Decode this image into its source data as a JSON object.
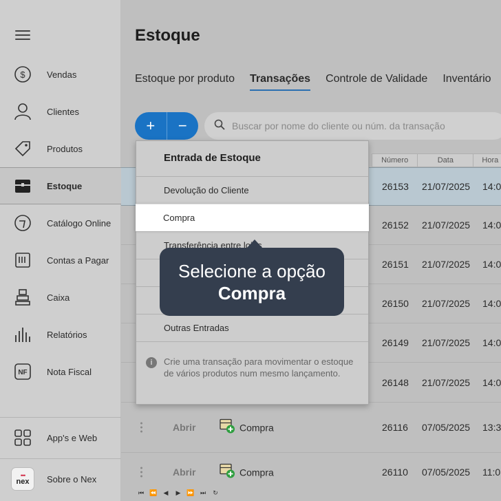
{
  "sidebar": {
    "items": [
      {
        "label": "Vendas",
        "icon": "dollar-circle-icon"
      },
      {
        "label": "Clientes",
        "icon": "person-icon"
      },
      {
        "label": "Produtos",
        "icon": "tag-icon"
      },
      {
        "label": "Estoque",
        "icon": "box-icon"
      },
      {
        "label": "Catálogo Online",
        "icon": "catalog-icon"
      },
      {
        "label": "Contas a Pagar",
        "icon": "bill-icon"
      },
      {
        "label": "Caixa",
        "icon": "cash-register-icon"
      },
      {
        "label": "Relatórios",
        "icon": "bar-chart-icon"
      },
      {
        "label": "Nota Fiscal",
        "icon": "nf-icon"
      }
    ],
    "apps_label": "App's e Web",
    "about_label": "Sobre o Nex",
    "logo_text": "nex"
  },
  "page": {
    "title": "Estoque",
    "tabs": [
      "Estoque por produto",
      "Transações",
      "Controle de Validade",
      "Inventário"
    ],
    "active_tab": "Transações",
    "add_symbol": "+",
    "remove_symbol": "−",
    "search_placeholder": "Buscar por nome do cliente ou núm. da transação"
  },
  "table": {
    "columns": [
      "Número",
      "Data",
      "Hora"
    ],
    "rows": [
      {
        "numero": "26153",
        "data": "21/07/2025",
        "hora": "14:0"
      },
      {
        "numero": "26152",
        "data": "21/07/2025",
        "hora": "14:0"
      },
      {
        "numero": "26151",
        "data": "21/07/2025",
        "hora": "14:0"
      },
      {
        "numero": "26150",
        "data": "21/07/2025",
        "hora": "14:0"
      },
      {
        "numero": "26149",
        "data": "21/07/2025",
        "hora": "14:0"
      },
      {
        "numero": "26148",
        "data": "21/07/2025",
        "hora": "14:0"
      },
      {
        "acao": "Abrir",
        "tipo": "Compra",
        "numero": "26116",
        "data": "07/05/2025",
        "hora": "13:3"
      },
      {
        "acao": "Abrir",
        "tipo": "Compra",
        "numero": "26110",
        "data": "07/05/2025",
        "hora": "11:0"
      }
    ],
    "pager": [
      "⏮",
      "⏪",
      "◀",
      "▶",
      "⏩",
      "⏭",
      "↻"
    ]
  },
  "dropdown": {
    "title": "Entrada de Estoque",
    "items": [
      "Devolução do Cliente",
      "Compra",
      "Transferência entre lojas",
      "",
      "",
      "Outras Entradas"
    ],
    "highlighted": "Compra",
    "info": "Crie uma transação para movimentar o estoque de vários produtos num mesmo lançamento."
  },
  "tooltip": {
    "line1": "Selecione a opção",
    "line2": "Compra"
  },
  "colors": {
    "accent": "#1a73c4",
    "tooltip_bg": "#343e4e",
    "selected_row": "#b9c8d1",
    "add_badge": "#2e9e3f"
  }
}
